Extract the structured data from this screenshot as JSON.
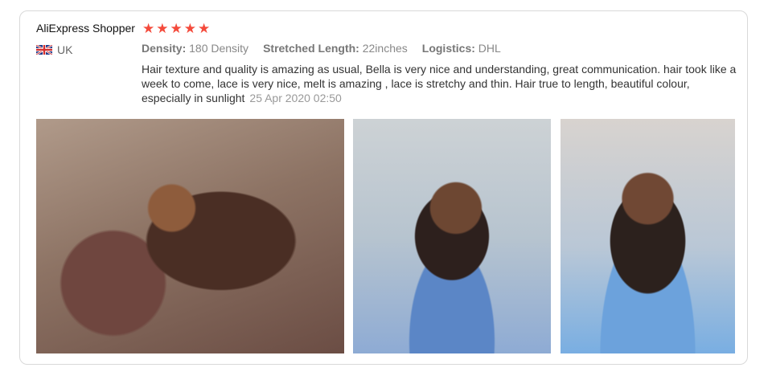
{
  "review": {
    "reviewer": "AliExpress Shopper",
    "rating": 5,
    "country": "UK",
    "meta": {
      "density_label": "Density:",
      "density_value": "180 Density",
      "length_label": "Stretched Length:",
      "length_value": "22inches",
      "logistics_label": "Logistics:",
      "logistics_value": "DHL"
    },
    "text": "Hair texture and quality is amazing as usual, Bella is very nice and understanding, great communication. hair took like a week to come, lace is very nice, melt is amazing , lace is stretchy and thin. Hair true to length, beautiful colour, especially in sunlight",
    "date": "25 Apr 2020 02:50",
    "photos": [
      "photo-1",
      "photo-2",
      "photo-3"
    ],
    "colors": {
      "star": "#f44a3b",
      "border": "#d9d9d9",
      "muted": "#888888"
    },
    "icons": {
      "flag": "uk-flag-icon",
      "star": "star-icon"
    }
  }
}
